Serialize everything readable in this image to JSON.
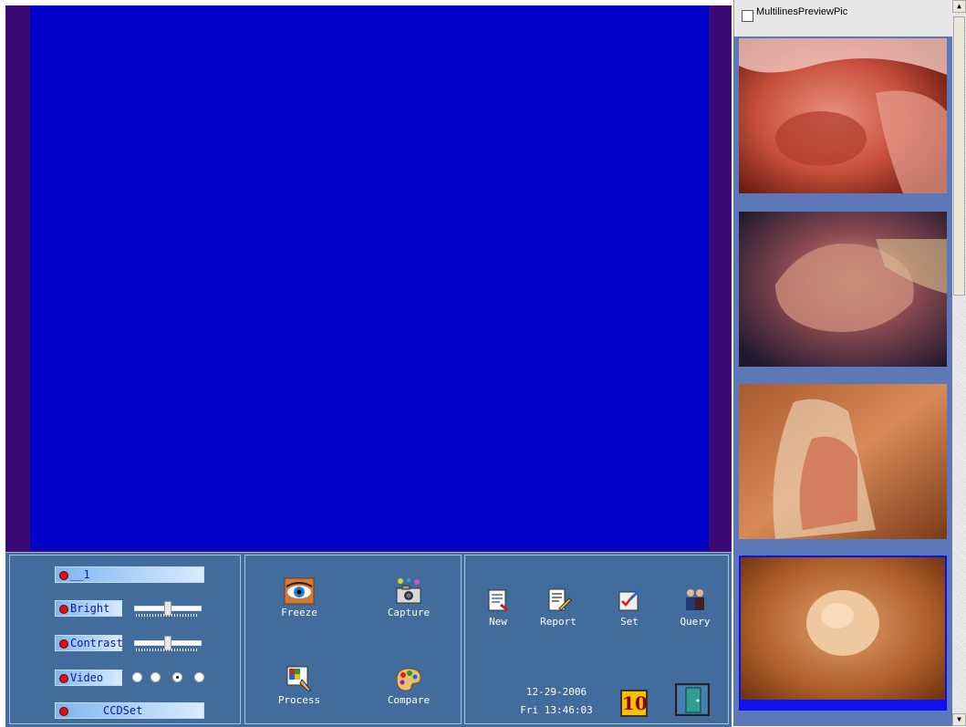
{
  "controls": {
    "channel_label": "__1",
    "bright_label": "Bright",
    "contrast_label": "Contrast",
    "video_label": "Video",
    "ccdset_label": "CCDSet",
    "bright_value": 0.5,
    "contrast_value": 0.5,
    "video_selected_index": 2
  },
  "tools": {
    "freeze_label": "Freeze",
    "capture_label": "Capture",
    "process_label": "Process",
    "compare_label": "Compare"
  },
  "actions": {
    "new_label": "New",
    "report_label": "Report",
    "set_label": "Set",
    "query_label": "Query"
  },
  "status": {
    "date": "12-29-2006",
    "time": "Fri 13:46:03",
    "count": "10"
  },
  "preview": {
    "multilines_label": "MultilinesPreviewPic",
    "multilines_checked": false
  },
  "colors": {
    "video_bg": "#0000c8",
    "panel_bg": "#426c9b",
    "thumb_panel_bg": "#5c78b6"
  }
}
